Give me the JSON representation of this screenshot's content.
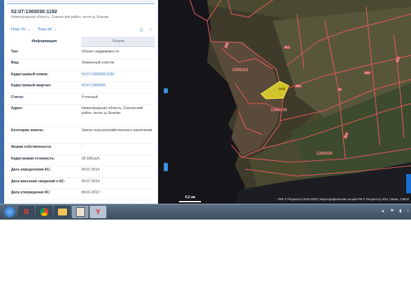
{
  "panel": {
    "cadastral_number_title": "52:07:1300030:1192",
    "address_line": "Нижегородская область, Сокольский район, около д. Быково",
    "links": [
      "План ЗУ →",
      "План КК →"
    ],
    "tabs": [
      "Информация",
      "Услуги"
    ],
    "fields": [
      {
        "label": "Тип:",
        "value": "Объект недвижимости",
        "link": false
      },
      {
        "label": "Вид:",
        "value": "Земельный участок",
        "link": false
      },
      {
        "label": "Кадастровый номер:",
        "value": "52:07:1300030:1192",
        "link": true
      },
      {
        "label": "Кадастровый квартал:",
        "value": "52:07:1300030",
        "link": true
      },
      {
        "label": "Статус:",
        "value": "Учтенный",
        "link": false
      },
      {
        "label": "Адрес:",
        "value": "Нижегородская область, Сокольский район, около д. Быково",
        "link": false
      },
      {
        "label": "Категория земель:",
        "value": "Земли сельскохозяйственного назначения",
        "link": false
      },
      {
        "label": "Форма собственности:",
        "value": "-",
        "link": false
      },
      {
        "label": "Кадастровая стоимость:",
        "value": "18 328 руб.",
        "link": false
      },
      {
        "label": "Дата определения КС:",
        "value": "04.07.2014",
        "link": false
      },
      {
        "label": "Дата внесения сведений о КС:",
        "value": "04.07.2014",
        "link": false
      },
      {
        "label": "Дата утверждения КС:",
        "value": "09.01.2012",
        "link": false
      }
    ]
  },
  "map": {
    "quarter_labels": [
      "1300013",
      "1300030",
      "1300030"
    ],
    "parcel_labels": [
      "1192",
      "831",
      "829",
      "832",
      "859",
      "854",
      "811",
      "13"
    ],
    "scale_label": "0,2 км",
    "attribution": "ПКК © Росреестр 2010-2020 | Картографическая основа РФ © Росреестр 2011 | Маке, CNES/"
  },
  "colors": {
    "panel_accent": "#2a6bb8",
    "boundary": "#e05a5a",
    "selected_parcel": "#e6d92a",
    "water": "#16161c"
  },
  "taskbar": {
    "apps": [
      "Я",
      "chrome-icon",
      "folder-icon",
      "contacts-icon",
      "Y"
    ]
  }
}
